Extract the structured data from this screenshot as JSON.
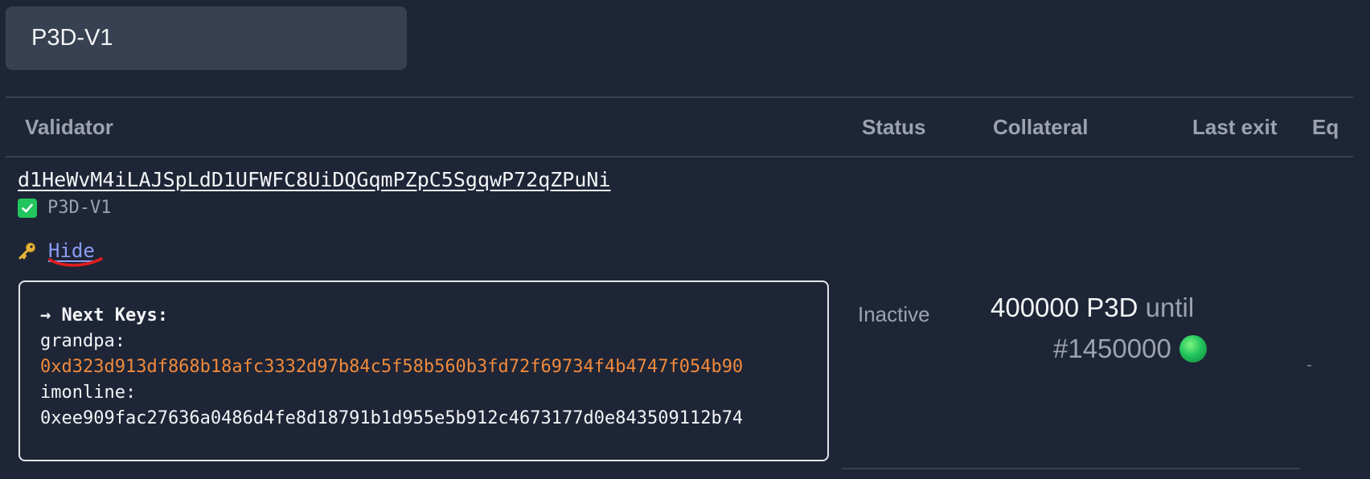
{
  "filter": {
    "value": "P3D-V1"
  },
  "table": {
    "headers": {
      "validator": "Validator",
      "status": "Status",
      "collateral": "Collateral",
      "last_exit": "Last exit",
      "eq": "Eq"
    },
    "row": {
      "address": "d1HeWvM4iLAJSpLdD1UFWFC8UiDQGqmPZpC5SgqwP72qZPuNi",
      "verified_label": "P3D-V1",
      "keys_toggle_label": "Hide",
      "next_keys": {
        "title": "→ Next Keys:",
        "grandpa_label": "grandpa:",
        "grandpa_value": "0xd323d913df868b18afc3332d97b84c5f58b560b3fd72f69734f4b4747f054b90",
        "imonline_label": "imonline:",
        "imonline_value": "0xee909fac27636a0486d4fe8d18791b1d955e5b912c4673177d0e843509112b74"
      },
      "status": "Inactive",
      "collateral_amount": "400000 P3D",
      "collateral_until": "until",
      "collateral_block": "#1450000"
    }
  },
  "icons": {
    "verified": "check-mark-icon",
    "keys": "key-icon",
    "collateral_status": "green-circle-icon"
  },
  "colors": {
    "background": "#1e2536",
    "link": "#8b9cf5",
    "grandpa_key": "#f08a3c",
    "annotation": "#e11d1d",
    "success": "#22c55e"
  }
}
